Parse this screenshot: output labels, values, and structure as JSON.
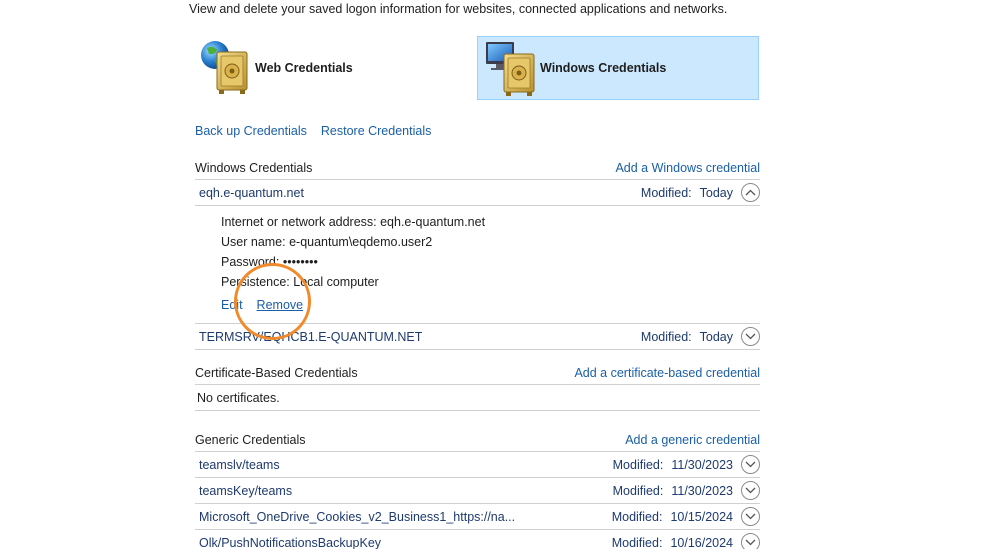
{
  "intro_text": "View and delete your saved logon information for websites, connected applications and networks.",
  "tiles": {
    "web": {
      "label": "Web Credentials"
    },
    "windows": {
      "label": "Windows Credentials"
    }
  },
  "actions": {
    "backup": "Back up Credentials",
    "restore": "Restore Credentials"
  },
  "windows_section": {
    "title": "Windows Credentials",
    "add_link": "Add a Windows credential",
    "expanded": {
      "name": "eqh.e-quantum.net",
      "modified_label": "Modified:",
      "modified_value": "Today",
      "address_line": "Internet or network address:  eqh.e-quantum.net",
      "user_line": "User name:  e-quantum\\eqdemo.user2",
      "password_line": "Password:  ••••••••",
      "persistence_line": "Persistence:  Local computer",
      "edit": "Edit",
      "remove": "Remove"
    },
    "items": [
      {
        "name": "TERMSRV/EQHCB1.E-QUANTUM.NET",
        "modified_label": "Modified:",
        "modified_value": "Today"
      }
    ]
  },
  "certificate_section": {
    "title": "Certificate-Based Credentials",
    "add_link": "Add a certificate-based credential",
    "empty_text": "No certificates."
  },
  "generic_section": {
    "title": "Generic Credentials",
    "add_link": "Add a generic credential",
    "items": [
      {
        "name": "teamslv/teams",
        "modified_label": "Modified:",
        "modified_value": "11/30/2023"
      },
      {
        "name": "teamsKey/teams",
        "modified_label": "Modified:",
        "modified_value": "11/30/2023"
      },
      {
        "name": "Microsoft_OneDrive_Cookies_v2_Business1_https://na...",
        "modified_label": "Modified:",
        "modified_value": "10/15/2024"
      },
      {
        "name": "Olk/PushNotificationsBackupKey",
        "modified_label": "Modified:",
        "modified_value": "10/16/2024"
      }
    ]
  },
  "colors": {
    "link": "#1a5fa6",
    "selected_tile_bg": "#cce8ff",
    "highlight_ring": "#f08a2b"
  }
}
